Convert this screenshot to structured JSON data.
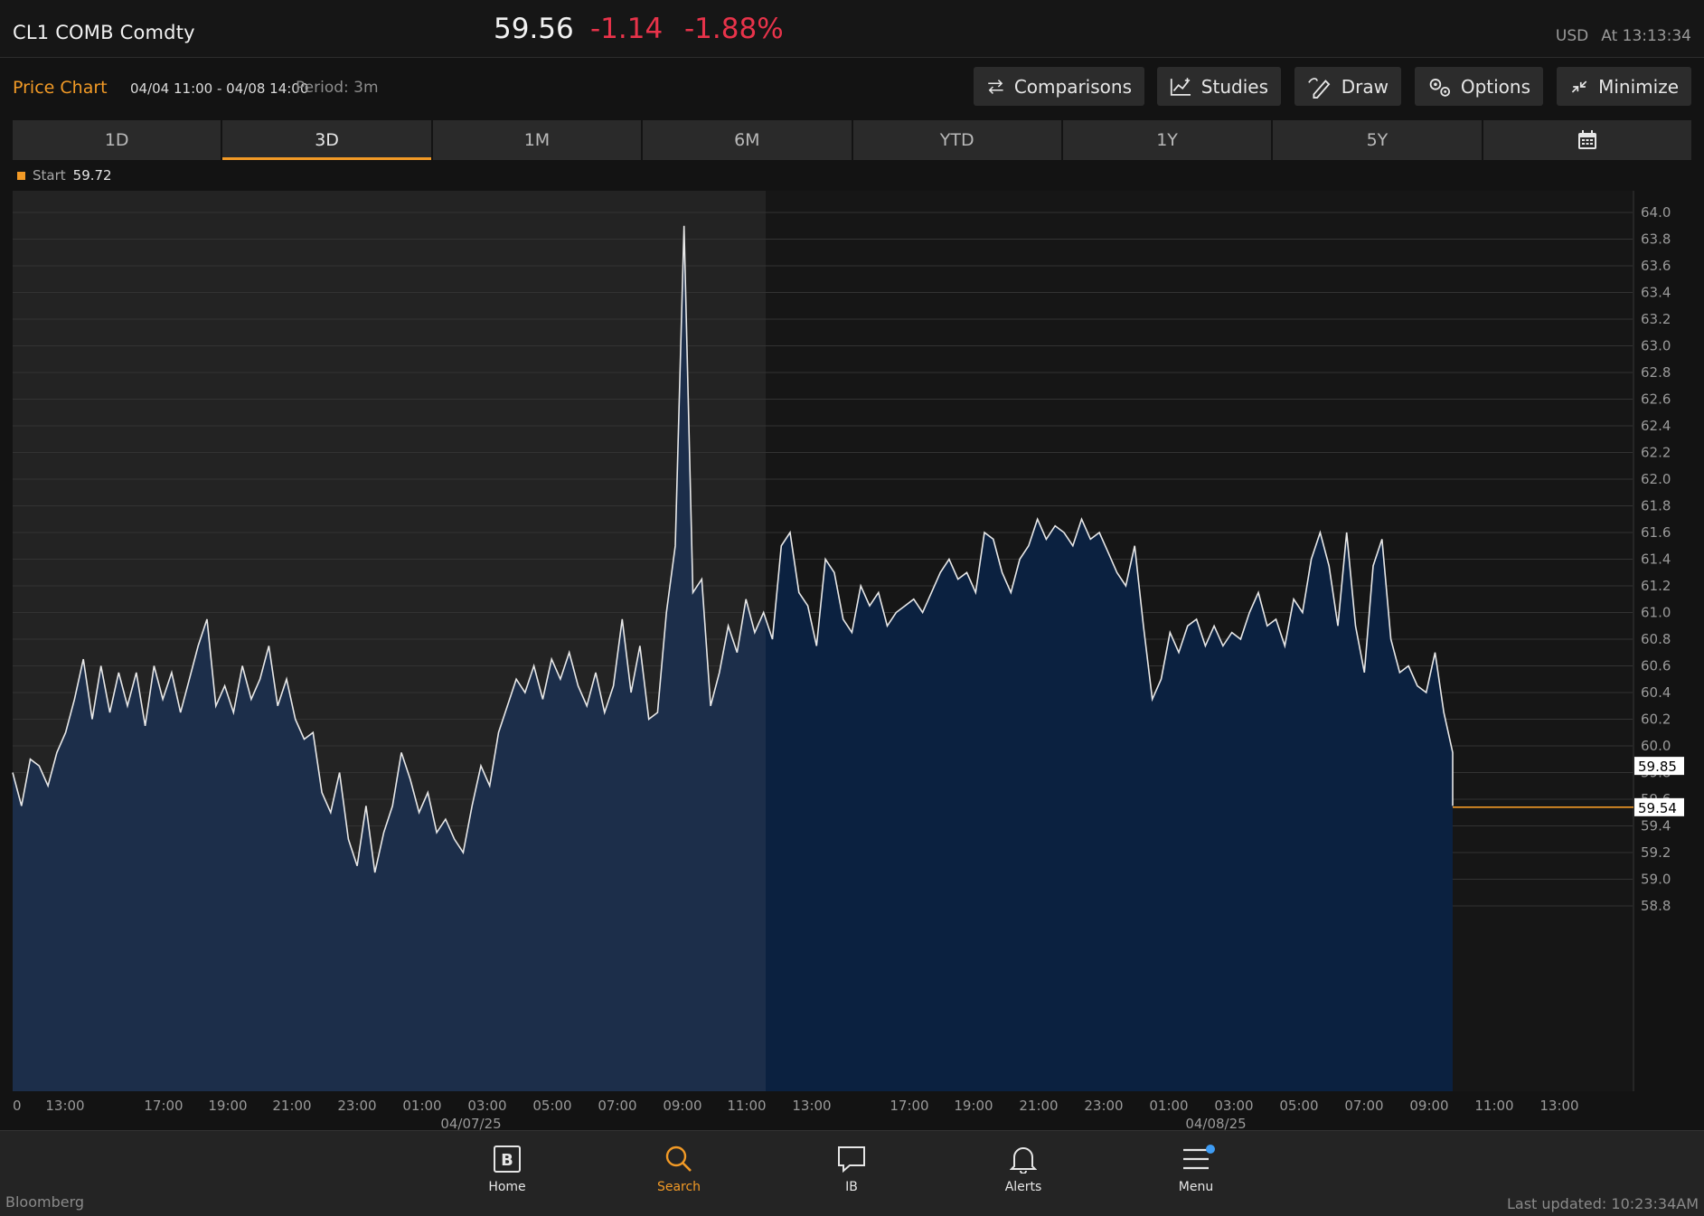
{
  "header": {
    "ticker": "CL1 COMB Comdty",
    "last_price": "59.56",
    "change": "-1.14",
    "change_pct": "-1.88%",
    "currency": "USD",
    "as_of": "At 13:13:34"
  },
  "toolbar": {
    "title": "Price Chart",
    "date_range": "04/04 11:00 - 04/08 14:00",
    "period": "Period: 3m",
    "buttons": {
      "comparisons": "Comparisons",
      "studies": "Studies",
      "draw": "Draw",
      "options": "Options",
      "minimize": "Minimize"
    }
  },
  "tabs": [
    "1D",
    "3D",
    "1M",
    "6M",
    "YTD",
    "1Y",
    "5Y"
  ],
  "active_tab": "3D",
  "legend": {
    "label": "Start",
    "value": "59.72"
  },
  "colors": {
    "accent": "#f29a26",
    "negative": "#e8334a",
    "area_left": "#1c2e4a",
    "area_right": "#0b2140",
    "line": "#e8e8e8"
  },
  "chart_data": {
    "type": "area",
    "title": "",
    "xlabel": "",
    "ylabel": "",
    "ylim": [
      58.8,
      64.1
    ],
    "y_ticks": [
      "64.0",
      "63.8",
      "63.6",
      "63.4",
      "63.2",
      "63.0",
      "62.8",
      "62.6",
      "62.4",
      "62.2",
      "62.0",
      "61.8",
      "61.6",
      "61.4",
      "61.2",
      "61.0",
      "60.8",
      "60.6",
      "60.4",
      "60.2",
      "60.0",
      "59.8",
      "59.6",
      "59.4",
      "59.2",
      "59.0",
      "58.8"
    ],
    "x_ticks": [
      "0",
      "13:00",
      "17:00",
      "19:00",
      "21:00",
      "23:00",
      "01:00",
      "03:00",
      "05:00",
      "07:00",
      "09:00",
      "11:00",
      "13:00",
      "17:00",
      "19:00",
      "21:00",
      "23:00",
      "01:00",
      "03:00",
      "05:00",
      "07:00",
      "09:00",
      "11:00",
      "13:00"
    ],
    "date_labels": [
      "04/07/25",
      "04/08/25"
    ],
    "series": [
      {
        "values": [
          59.8,
          59.55,
          59.9,
          59.85,
          59.7,
          59.95,
          60.1,
          60.35,
          60.65,
          60.2,
          60.6,
          60.25,
          60.55,
          60.3,
          60.55,
          60.15,
          60.6,
          60.35,
          60.55,
          60.25,
          60.5,
          60.75,
          60.95,
          60.3,
          60.45,
          60.25,
          60.6,
          60.35,
          60.5,
          60.75,
          60.3,
          60.5,
          60.2,
          60.05,
          60.1,
          59.65,
          59.5,
          59.8,
          59.3,
          59.1,
          59.55,
          59.05,
          59.35,
          59.55,
          59.95,
          59.75,
          59.5,
          59.65,
          59.35,
          59.45,
          59.3,
          59.2,
          59.55,
          59.85,
          59.7,
          60.1,
          60.3,
          60.5,
          60.4,
          60.6,
          60.35,
          60.65,
          60.5,
          60.7,
          60.45,
          60.3,
          60.55,
          60.25,
          60.45,
          60.95,
          60.4,
          60.75,
          60.2,
          60.25,
          61.0,
          61.5,
          63.9,
          61.15,
          61.25,
          60.3,
          60.55,
          60.9,
          60.7,
          61.1,
          60.85,
          61.0,
          60.8,
          61.5,
          61.6,
          61.15,
          61.05,
          60.75,
          61.4,
          61.3,
          60.95,
          60.85,
          61.2,
          61.05,
          61.15,
          60.9,
          61.0,
          61.05,
          61.1,
          61.0,
          61.15,
          61.3,
          61.4,
          61.25,
          61.3,
          61.15,
          61.6,
          61.55,
          61.3,
          61.15,
          61.4,
          61.5,
          61.7,
          61.55,
          61.65,
          61.6,
          61.5,
          61.7,
          61.55,
          61.6,
          61.45,
          61.3,
          61.2,
          61.5,
          60.9,
          60.35,
          60.5,
          60.85,
          60.7,
          60.9,
          60.95,
          60.75,
          60.9,
          60.75,
          60.85,
          60.8,
          61.0,
          61.15,
          60.9,
          60.95,
          60.75,
          61.1,
          61.0,
          61.4,
          61.6,
          61.35,
          60.9,
          61.6,
          60.9,
          60.55,
          61.35,
          61.55,
          60.8,
          60.55,
          60.6,
          60.45,
          60.4,
          60.7,
          60.25,
          59.95,
          59.6,
          59.55,
          59.55,
          59.55,
          59.55,
          59.55
        ]
      }
    ],
    "right_labels": [
      "59.85",
      "59.54"
    ],
    "grid": true,
    "highlighted_session": "left portion shaded lighter"
  },
  "nav": {
    "items": [
      {
        "label": "Home"
      },
      {
        "label": "Search"
      },
      {
        "label": "IB"
      },
      {
        "label": "Alerts"
      },
      {
        "label": "Menu"
      }
    ]
  },
  "footer": {
    "brand": "Bloomberg",
    "updated": "Last updated: 10:23:34AM"
  }
}
